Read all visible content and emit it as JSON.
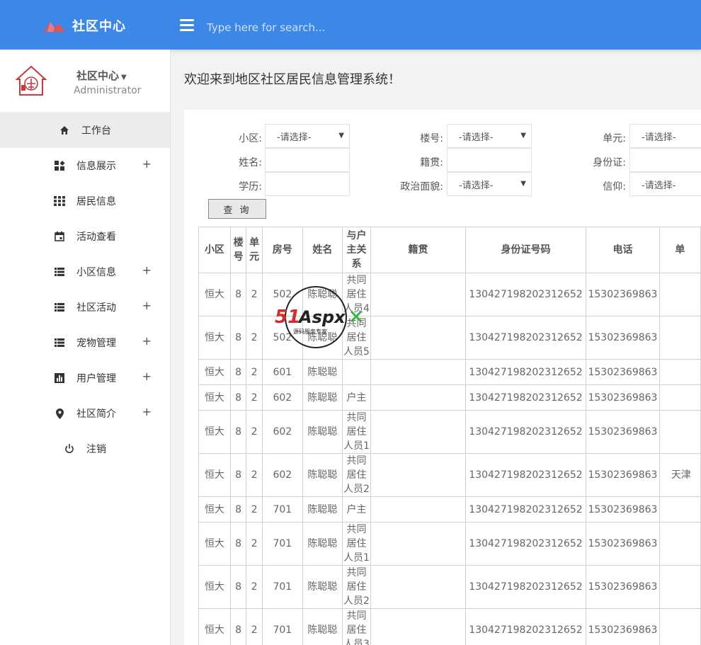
{
  "header": {
    "app_title": "社区中心",
    "search_placeholder": "Type here for search..."
  },
  "sidebar": {
    "profile": {
      "org": "社区中心",
      "role": "Administrator"
    },
    "items": [
      {
        "label": "工作台",
        "icon": "home-icon",
        "expandable": false,
        "active": true
      },
      {
        "label": "信息展示",
        "icon": "widgets-icon",
        "expandable": true
      },
      {
        "label": "居民信息",
        "icon": "grid-icon",
        "expandable": false
      },
      {
        "label": "活动查看",
        "icon": "calendar-icon",
        "expandable": false
      },
      {
        "label": "小区信息",
        "icon": "list-icon",
        "expandable": true
      },
      {
        "label": "社区活动",
        "icon": "list-icon",
        "expandable": true
      },
      {
        "label": "宠物管理",
        "icon": "list-icon",
        "expandable": true
      },
      {
        "label": "用户管理",
        "icon": "bar-chart-icon",
        "expandable": true
      },
      {
        "label": "社区简介",
        "icon": "location-pin-icon",
        "expandable": true
      },
      {
        "label": "注销",
        "icon": "power-icon",
        "expandable": false
      }
    ]
  },
  "main": {
    "welcome": "欢迎来到地区社区居民信息管理系统！",
    "filters": {
      "community_label": "小区:",
      "community_value": "-请选择-",
      "building_label": "楼号:",
      "building_value": "-请选择-",
      "unit_label": "单元:",
      "unit_value": "-请选择-",
      "name_label": "姓名:",
      "origin_label": "籍贯:",
      "idcard_label": "身份证:",
      "education_label": "学历:",
      "politics_label": "政治面貌:",
      "politics_value": "-请选择-",
      "religion_label": "信仰:",
      "religion_value": "-请选择-"
    },
    "query_button": "查 询",
    "table": {
      "headers": [
        "小区",
        "楼号",
        "单元",
        "房号",
        "姓名",
        "与户主关系",
        "籍贯",
        "身份证号码",
        "电话",
        "单"
      ],
      "rows": [
        [
          "恒大",
          "8",
          "2",
          "502",
          "陈聪聪",
          "共同居住人员4",
          "",
          "130427198202312652",
          "15302369863",
          ""
        ],
        [
          "恒大",
          "8",
          "2",
          "502",
          "陈聪聪",
          "共同居住人员5",
          "",
          "130427198202312652",
          "15302369863",
          ""
        ],
        [
          "恒大",
          "8",
          "2",
          "601",
          "陈聪聪",
          "",
          "",
          "130427198202312652",
          "15302369863",
          ""
        ],
        [
          "恒大",
          "8",
          "2",
          "602",
          "陈聪聪",
          "户主",
          "",
          "130427198202312652",
          "15302369863",
          ""
        ],
        [
          "恒大",
          "8",
          "2",
          "602",
          "陈聪聪",
          "共同居住人员1",
          "",
          "130427198202312652",
          "15302369863",
          ""
        ],
        [
          "恒大",
          "8",
          "2",
          "602",
          "陈聪聪",
          "共同居住人员2",
          "",
          "130427198202312652",
          "15302369863",
          "天津"
        ],
        [
          "恒大",
          "8",
          "2",
          "701",
          "陈聪聪",
          "户主",
          "",
          "130427198202312652",
          "15302369863",
          ""
        ],
        [
          "恒大",
          "8",
          "2",
          "701",
          "陈聪聪",
          "共同居住人员1",
          "",
          "130427198202312652",
          "15302369863",
          ""
        ],
        [
          "恒大",
          "8",
          "2",
          "701",
          "陈聪聪",
          "共同居住人员2",
          "",
          "130427198202312652",
          "15302369863",
          ""
        ],
        [
          "恒大",
          "8",
          "2",
          "701",
          "陈聪聪",
          "共同居住人员3",
          "",
          "130427198202312652",
          "15302369863",
          ""
        ]
      ]
    }
  },
  "watermark": {
    "brand": "51Aspx",
    "tagline": "源码服务专家"
  },
  "colors": {
    "topbar": "#3d87e6",
    "sidebar_bg": "#ffffff",
    "active_item": "#ececec",
    "logo_red": "#e0535a"
  }
}
